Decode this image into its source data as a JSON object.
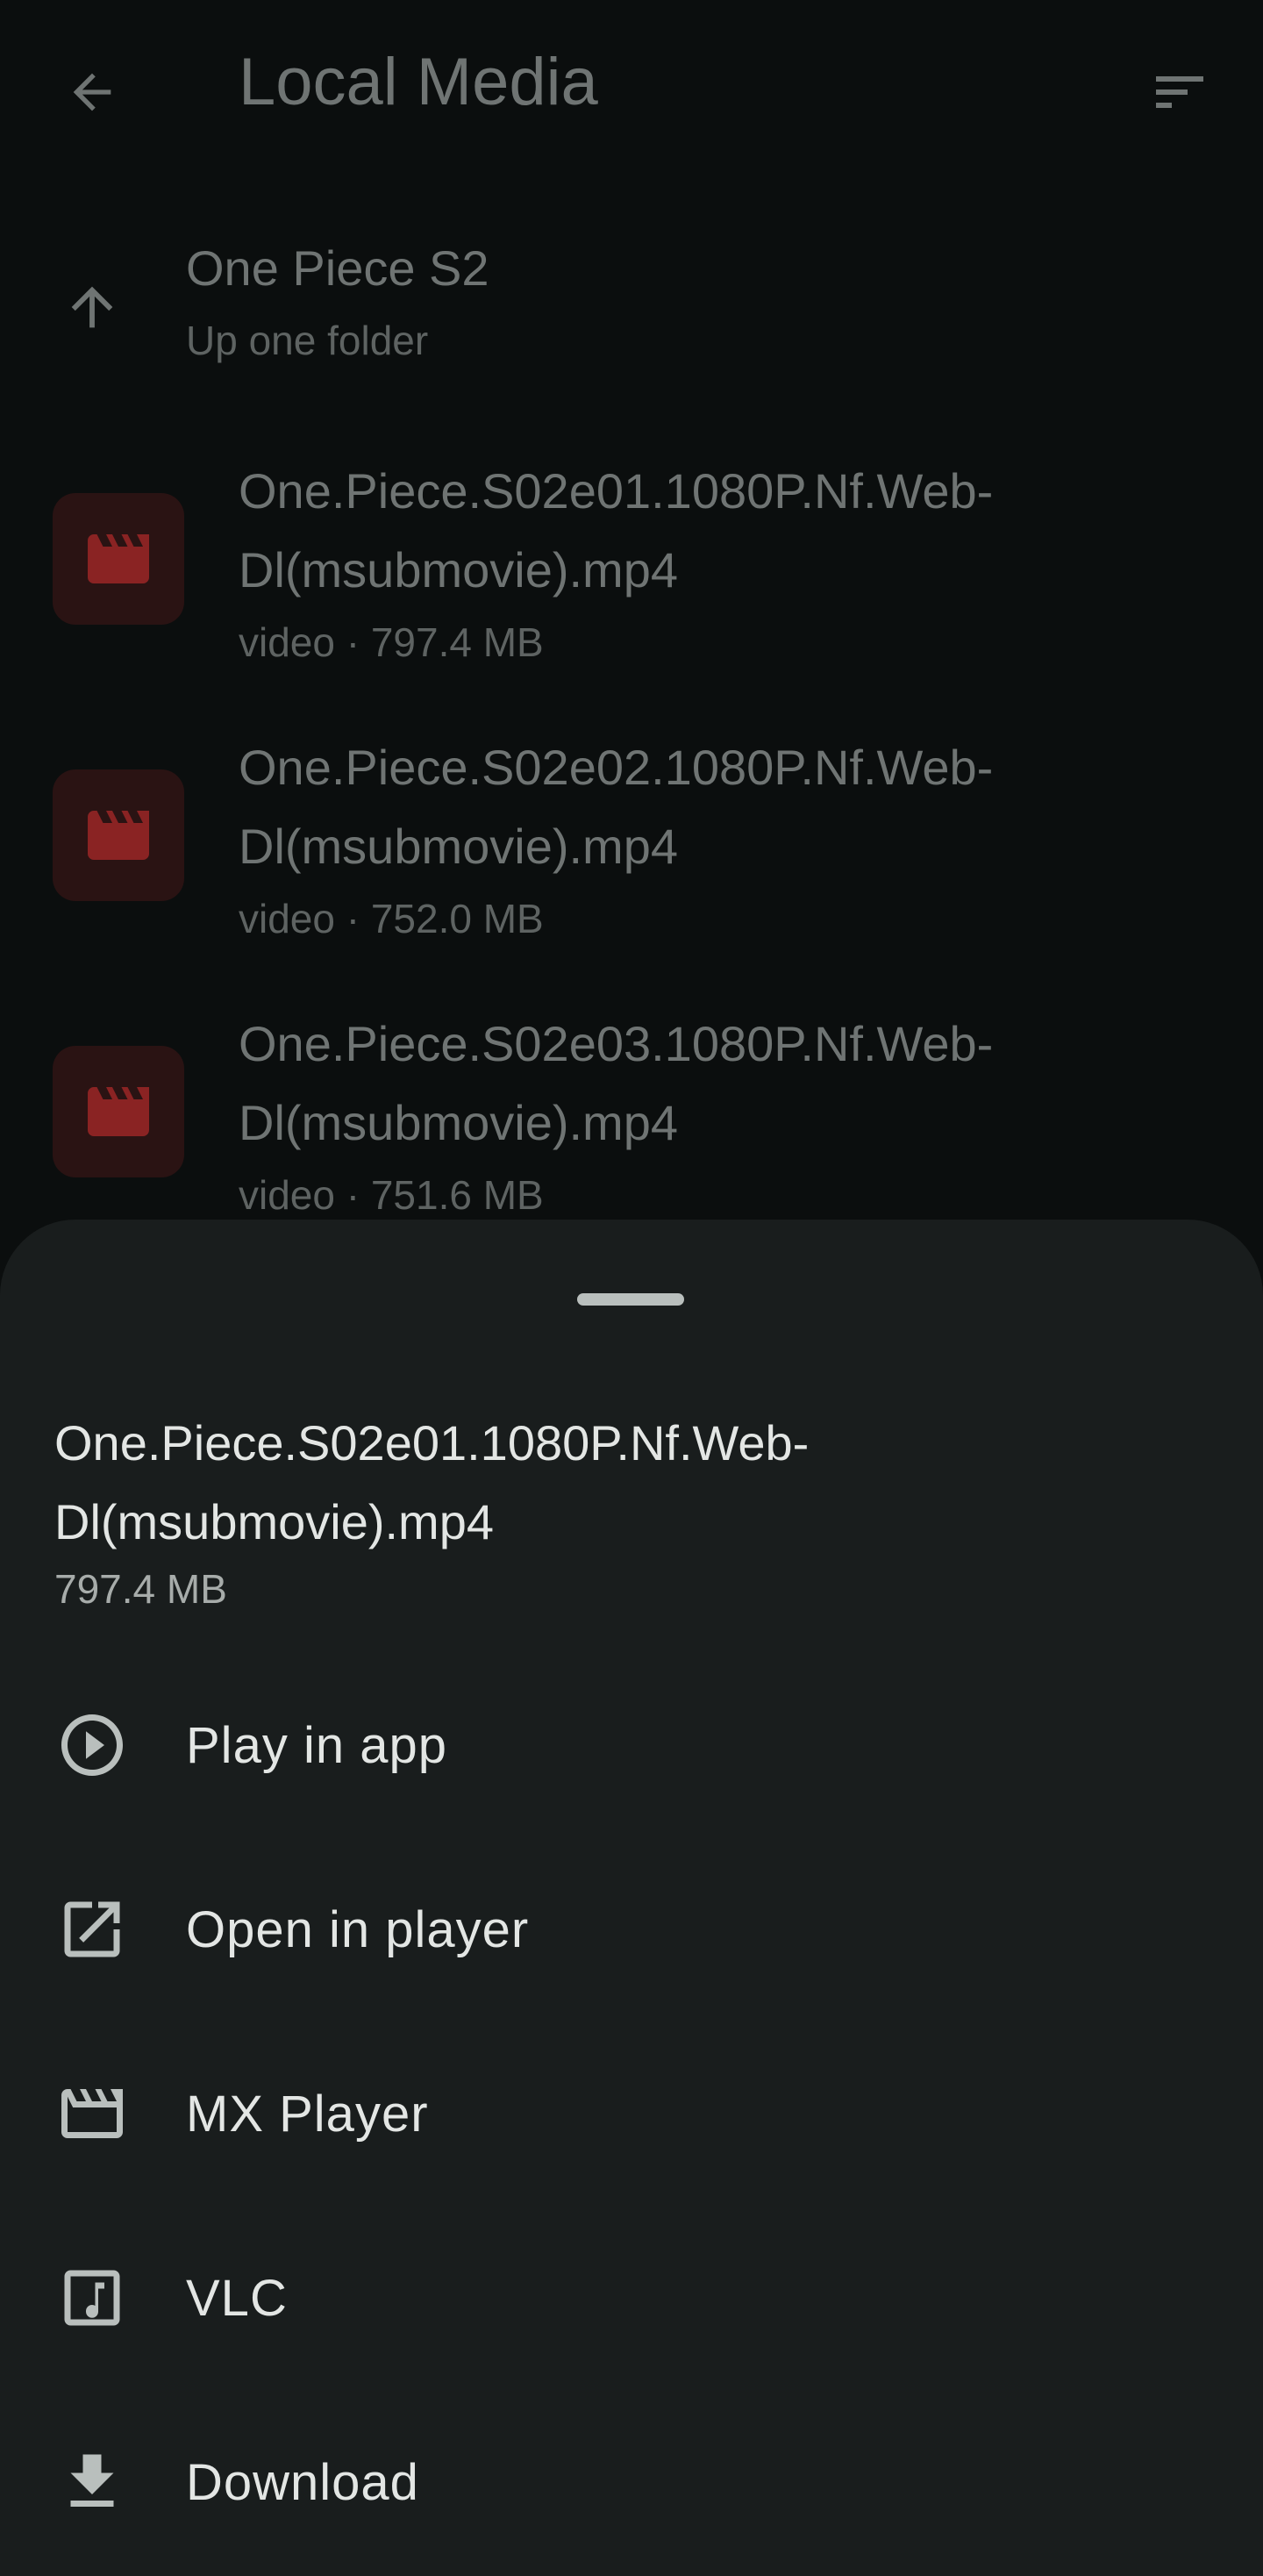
{
  "header": {
    "title": "Local Media"
  },
  "parent_folder": {
    "name": "One Piece S2",
    "subtitle": "Up one folder"
  },
  "files": [
    {
      "name": "One.Piece.S02e01.1080P.Nf.Web-Dl(msubmovie).mp4",
      "meta": "video · 797.4 MB"
    },
    {
      "name": "One.Piece.S02e02.1080P.Nf.Web-Dl(msubmovie).mp4",
      "meta": "video · 752.0 MB"
    },
    {
      "name": "One.Piece.S02e03.1080P.Nf.Web-Dl(msubmovie).mp4",
      "meta": "video · 751.6 MB"
    }
  ],
  "sheet": {
    "title": "One.Piece.S02e01.1080P.Nf.Web-Dl(msubmovie).mp4",
    "size": "797.4 MB",
    "actions": [
      {
        "label": "Play in app",
        "icon": "play-circle-icon"
      },
      {
        "label": "Open in player",
        "icon": "open-external-icon"
      },
      {
        "label": "MX Player",
        "icon": "clapperboard-icon"
      },
      {
        "label": "VLC",
        "icon": "music-note-icon"
      },
      {
        "label": "Download",
        "icon": "download-icon"
      }
    ]
  },
  "colors": {
    "background": "#0b0e0e",
    "sheet": "#191d1d",
    "thumb_bg": "#2a1313",
    "thumb_icon": "#8a2323",
    "dim_text": "#6f7473",
    "sheet_text": "#e3e6e4"
  }
}
